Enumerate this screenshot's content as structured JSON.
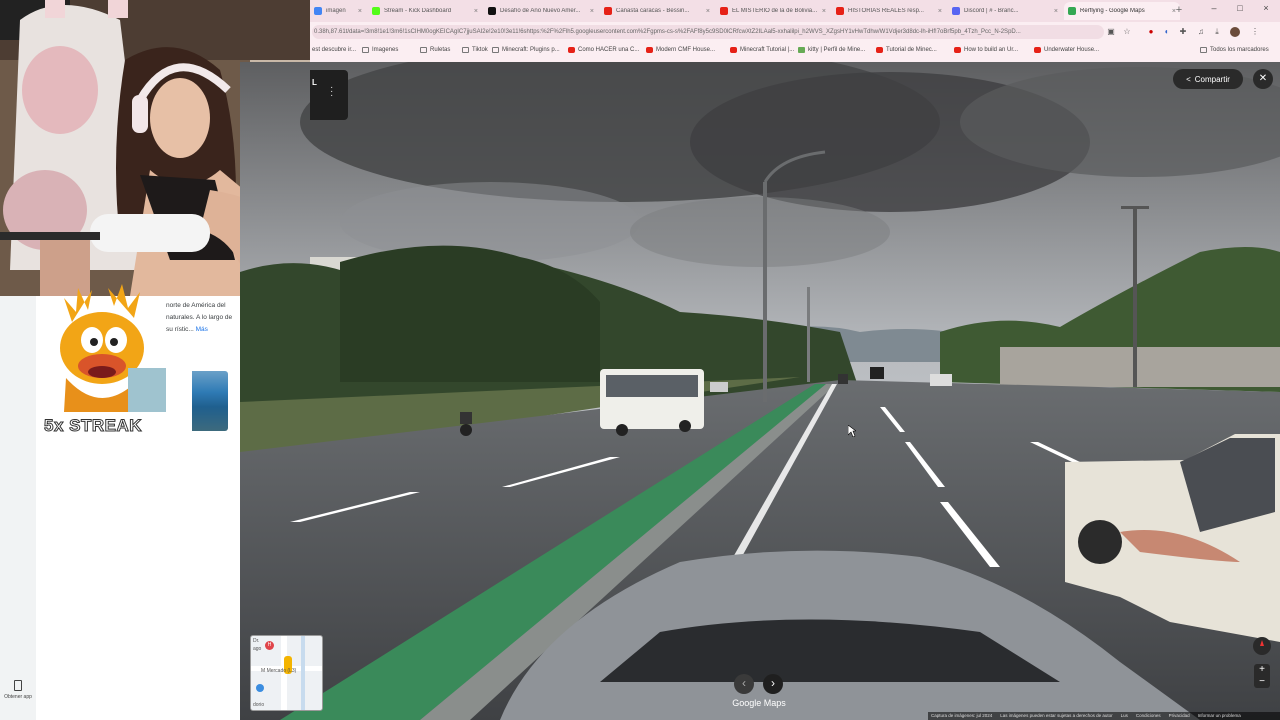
{
  "browser": {
    "tabs": [
      {
        "label": "imagen",
        "color": "#4285f4",
        "active": false
      },
      {
        "label": "Stream - Kick Dashboard",
        "color": "#53fc18",
        "active": false
      },
      {
        "label": "Desafío de Año Nuevo Amer...",
        "color": "#111111",
        "active": false
      },
      {
        "label": "Canasta caracas - Bessin...",
        "color": "#e62117",
        "active": false
      },
      {
        "label": "EL MISTERIO de la de Bolivia...",
        "color": "#e62117",
        "active": false
      },
      {
        "label": "HISTORIAS REALES resp...",
        "color": "#e62117",
        "active": false
      },
      {
        "label": "Discord | # - Branc...",
        "color": "#5865f2",
        "active": false
      },
      {
        "label": "Rerflying - Google Maps",
        "color": "#34a853",
        "active": true
      }
    ],
    "url": "0.38h,87.61t/data=!3m8!1e1!3m6!1sCIHM0ogKEICAgIC7jjuSAI2e!2e10!3e11!6shttps:%2F%2Flh5.googleusercontent.com%2Fgpms-cs-s%2FAFf8y5c9SD0lCRfcwXtZ2ILAal5-xxhalilpi_h2WVS_XZgsHY1vHwTdhw/W1Vdjer3d8dc-lh-iHf!7oBrf5pb_4Tzh_Pcc_N-2SpD...",
    "bookmarks": [
      {
        "label": "est descubre ir...",
        "icon": "none"
      },
      {
        "label": "Imagenes",
        "icon": "folder"
      },
      {
        "label": "Ruletas",
        "icon": "folder"
      },
      {
        "label": "Tiktok",
        "icon": "folder"
      },
      {
        "label": "Minecraft: Plugins p...",
        "icon": "folder"
      },
      {
        "label": "Como HACER una C...",
        "icon": "yt"
      },
      {
        "label": "Modern CMF House...",
        "icon": "yt"
      },
      {
        "label": "Minecraft Tutorial |...",
        "icon": "yt"
      },
      {
        "label": "kitty | Perfil de Mine...",
        "icon": "mc"
      },
      {
        "label": "Tutorial de Minec...",
        "icon": "yt"
      },
      {
        "label": "How to build an Ur...",
        "icon": "yt"
      },
      {
        "label": "Underwater House...",
        "icon": "yt"
      }
    ],
    "all_bookmarks": "Todos los marcadores",
    "new_tab": "+",
    "window_controls": [
      "–",
      "□",
      "×"
    ]
  },
  "streetview": {
    "location_label": "L",
    "share_label": "Compartir",
    "close": "✕",
    "prev": "‹",
    "next": "›",
    "google_maps": "Google Maps",
    "zoom_in": "+",
    "zoom_out": "−",
    "minimap": {
      "labels": [
        "Dr.",
        "ago",
        "Mercado (L3)",
        "dorio"
      ],
      "metro": "M"
    },
    "footer": [
      "Captura de imágenes: jul 2024",
      "Las imágenes pueden estar sujetas a derechos de autor",
      "Lus",
      "Condiciones",
      "Privacidad",
      "Informar un problema"
    ]
  },
  "panel": {
    "description": "norte de América del naturales. A lo largo de su rístic...",
    "more": "Más",
    "get_app": "Obtener app"
  },
  "overlay": {
    "streak": "5x STREAK"
  }
}
